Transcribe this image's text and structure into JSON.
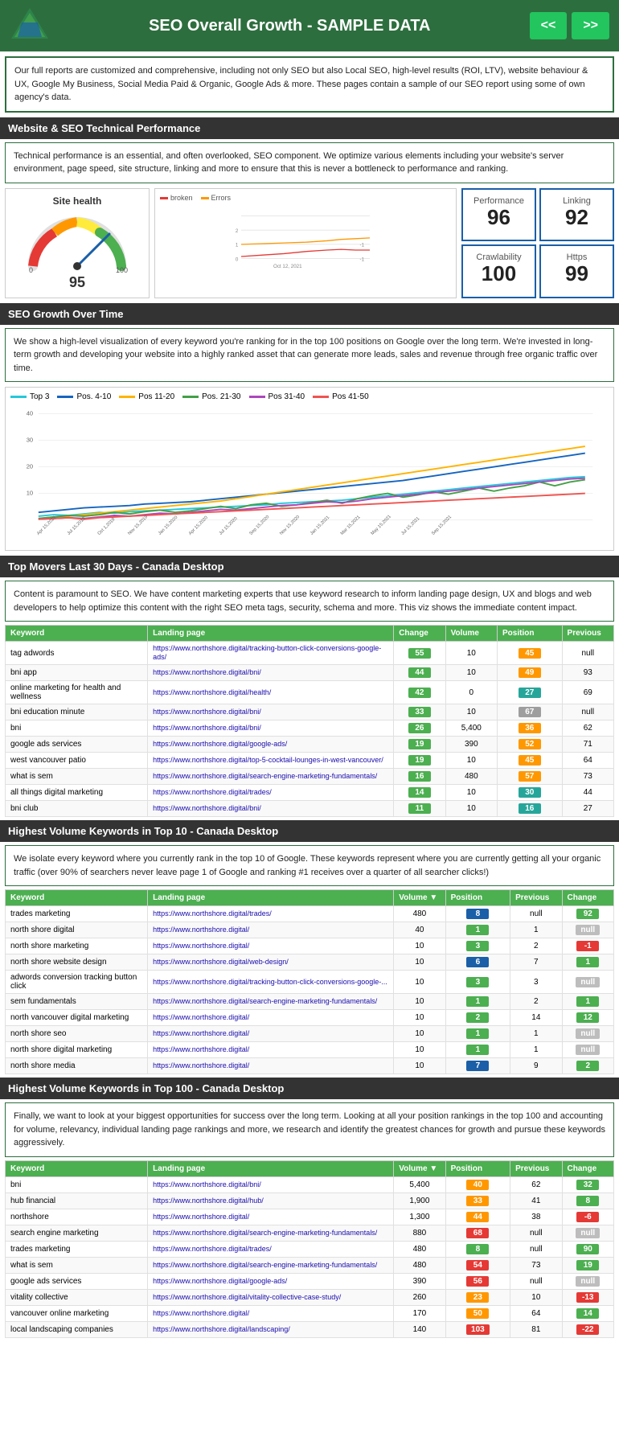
{
  "header": {
    "title": "SEO Overall Growth - SAMPLE DATA",
    "nav_prev": "<<",
    "nav_next": ">>"
  },
  "intro": {
    "text": "Our full reports are customized and comprehensive, including not only SEO but also Local SEO, high-level results (ROI, LTV), website behaviour & UX, Google My Business, Social Media Paid & Organic, Google Ads & more. These pages contain a sample of our SEO report using some of own agency's data."
  },
  "section_technical": {
    "title": "Website & SEO Technical Performance",
    "description": "Technical performance is an essential, and often overlooked, SEO component. We optimize various elements including your website's server environment, page speed, site structure, linking and more to ensure that this is never a bottleneck to performance and ranking.",
    "gauge": {
      "label": "Site health",
      "score": 95
    },
    "metrics": [
      {
        "label": "Performance",
        "value": "96"
      },
      {
        "label": "Linking",
        "value": "92"
      },
      {
        "label": "Crawlability",
        "value": "100"
      },
      {
        "label": "Https",
        "value": "99"
      }
    ],
    "chart_date": "Oct 12, 2021",
    "legend": [
      {
        "label": "broken",
        "color": "#e53935"
      },
      {
        "label": "Errors",
        "color": "#ff9800"
      }
    ]
  },
  "section_growth": {
    "title": "SEO Growth Over Time",
    "description": "We show a high-level visualization of every keyword you're ranking for in the top 100 positions on Google over the long term. We're invested in long-term growth and developing your website into a highly ranked asset that can generate more leads, sales and revenue through free organic traffic over time.",
    "legend": [
      {
        "label": "Top 3",
        "color": "#26c6da"
      },
      {
        "label": "Pos. 4-10",
        "color": "#1565c0"
      },
      {
        "label": "Pos 11-20",
        "color": "#ffb300"
      },
      {
        "label": "Pos. 21-30",
        "color": "#43a047"
      },
      {
        "label": "Pos 31-40",
        "color": "#ab47bc"
      },
      {
        "label": "Pos 41-50",
        "color": "#ef5350"
      }
    ]
  },
  "section_top_movers": {
    "title": "Top Movers Last 30 Days - Canada Desktop",
    "description": "Content is paramount to SEO. We have content marketing experts that use keyword research to inform landing page design, UX and blogs and web developers to help optimize this content with the right SEO meta tags, security, schema and more. This viz shows the immediate content impact.",
    "columns": [
      "Keyword",
      "Landing page",
      "Change",
      "Volume",
      "Position",
      "Previous"
    ],
    "rows": [
      {
        "keyword": "tag adwords",
        "url": "https://www.northshore.digital/tracking-button-click-conversions-google-ads/",
        "change": 55,
        "change_color": "green",
        "volume": 10,
        "position": 45,
        "previous": "null"
      },
      {
        "keyword": "bni app",
        "url": "https://www.northshore.digital/bni/",
        "change": 44,
        "change_color": "green",
        "volume": 10,
        "position": 49,
        "previous": 93
      },
      {
        "keyword": "online marketing for health and wellness",
        "url": "https://www.northshore.digital/health/",
        "change": 42,
        "change_color": "green",
        "volume": 0,
        "position": 27,
        "previous": 69
      },
      {
        "keyword": "bni education minute",
        "url": "https://www.northshore.digital/bni/",
        "change": 33,
        "change_color": "green",
        "volume": 10,
        "position": 67,
        "previous": "null"
      },
      {
        "keyword": "bni",
        "url": "https://www.northshore.digital/bni/",
        "change": 26,
        "change_color": "green",
        "volume": "5,400",
        "position": 36,
        "previous": 62
      },
      {
        "keyword": "google ads services",
        "url": "https://www.northshore.digital/google-ads/",
        "change": 19,
        "change_color": "green",
        "volume": 390,
        "position": 52,
        "previous": 71
      },
      {
        "keyword": "west vancouver patio",
        "url": "https://www.northshore.digital/top-5-cocktail-lounges-in-west-vancouver/",
        "change": 19,
        "change_color": "green",
        "volume": 10,
        "position": 45,
        "previous": 64
      },
      {
        "keyword": "what is sem",
        "url": "https://www.northshore.digital/search-engine-marketing-fundamentals/",
        "change": 16,
        "change_color": "green",
        "volume": 480,
        "position": 57,
        "previous": 73
      },
      {
        "keyword": "all things digital marketing",
        "url": "https://www.northshore.digital/trades/",
        "change": 14,
        "change_color": "green",
        "volume": 10,
        "position": 30,
        "previous": 44
      },
      {
        "keyword": "bni club",
        "url": "https://www.northshore.digital/bni/",
        "change": 11,
        "change_color": "green",
        "volume": 10,
        "position": 16,
        "previous": 27
      }
    ]
  },
  "section_top10": {
    "title": "Highest Volume Keywords in Top 10 - Canada Desktop",
    "description": "We isolate every keyword where you currently rank in the top 10 of Google. These keywords represent where you are currently getting all your organic traffic (over 90% of searchers never leave page 1 of Google and ranking #1 receives over a quarter of all searcher clicks!)",
    "columns": [
      "Keyword",
      "Landing page",
      "Volume ▼",
      "Position",
      "Previous",
      "Change"
    ],
    "rows": [
      {
        "keyword": "trades marketing",
        "url": "https://www.northshore.digital/trades/",
        "volume": 480,
        "position": 8,
        "previous": "null",
        "change": 92,
        "change_color": "green"
      },
      {
        "keyword": "north shore digital",
        "url": "https://www.northshore.digital/",
        "volume": 40,
        "position": 1,
        "previous": 1,
        "change": "null",
        "change_color": "null"
      },
      {
        "keyword": "north shore marketing",
        "url": "https://www.northshore.digital/",
        "volume": 10,
        "position": 3,
        "previous": 2,
        "change": -1,
        "change_color": "red"
      },
      {
        "keyword": "north shore website design",
        "url": "https://www.northshore.digital/web-design/",
        "volume": 10,
        "position": 6,
        "previous": 7,
        "change": 1,
        "change_color": "green"
      },
      {
        "keyword": "adwords conversion tracking button click",
        "url": "https://www.northshore.digital/tracking-button-click-conversions-google-...",
        "volume": 10,
        "position": 3,
        "previous": 3,
        "change": "null",
        "change_color": "null"
      },
      {
        "keyword": "sem fundamentals",
        "url": "https://www.northshore.digital/search-engine-marketing-fundamentals/",
        "volume": 10,
        "position": 1,
        "previous": 2,
        "change": 1,
        "change_color": "green"
      },
      {
        "keyword": "north vancouver digital marketing",
        "url": "https://www.northshore.digital/",
        "volume": 10,
        "position": 2,
        "previous": 14,
        "change": 12,
        "change_color": "green"
      },
      {
        "keyword": "north shore seo",
        "url": "https://www.northshore.digital/",
        "volume": 10,
        "position": 1,
        "previous": 1,
        "change": "null",
        "change_color": "null"
      },
      {
        "keyword": "north shore digital marketing",
        "url": "https://www.northshore.digital/",
        "volume": 10,
        "position": 1,
        "previous": 1,
        "change": "null",
        "change_color": "null"
      },
      {
        "keyword": "north shore media",
        "url": "https://www.northshore.digital/",
        "volume": 10,
        "position": 7,
        "previous": 9,
        "change": 2,
        "change_color": "green"
      }
    ]
  },
  "section_top100": {
    "title": "Highest Volume Keywords in Top 100 - Canada Desktop",
    "description": "Finally, we want to look at your biggest opportunities for success over the long term. Looking at all your position rankings in the top 100 and accounting for volume, relevancy, individual landing page rankings and more, we research and identify the greatest chances for growth and pursue these keywords aggressively.",
    "columns": [
      "Keyword",
      "Landing page",
      "Volume ▼",
      "Position",
      "Previous",
      "Change"
    ],
    "rows": [
      {
        "keyword": "bni",
        "url": "https://www.northshore.digital/bni/",
        "volume": "5,400",
        "position": 40,
        "previous": 62,
        "change": 32,
        "change_color": "green"
      },
      {
        "keyword": "hub financial",
        "url": "https://www.northshore.digital/hub/",
        "volume": "1,900",
        "position": 33,
        "previous": 41,
        "change": 8,
        "change_color": "green"
      },
      {
        "keyword": "northshore",
        "url": "https://www.northshore.digital/",
        "volume": "1,300",
        "position": 44,
        "previous": 38,
        "change": -6,
        "change_color": "red"
      },
      {
        "keyword": "search engine marketing",
        "url": "https://www.northshore.digital/search-engine-marketing-fundamentals/",
        "volume": 880,
        "position": 68,
        "previous": "null",
        "change": "null",
        "change_color": "null"
      },
      {
        "keyword": "trades marketing",
        "url": "https://www.northshore.digital/trades/",
        "volume": 480,
        "position": 8,
        "previous": "null",
        "change": 90,
        "change_color": "green"
      },
      {
        "keyword": "what is sem",
        "url": "https://www.northshore.digital/search-engine-marketing-fundamentals/",
        "volume": 480,
        "position": 54,
        "previous": 73,
        "change": 19,
        "change_color": "green"
      },
      {
        "keyword": "google ads services",
        "url": "https://www.northshore.digital/google-ads/",
        "volume": 390,
        "position": 56,
        "previous": "null",
        "change": "null",
        "change_color": "null"
      },
      {
        "keyword": "vitality collective",
        "url": "https://www.northshore.digital/vitality-collective-case-study/",
        "volume": 260,
        "position": 23,
        "previous": 10,
        "change": -13,
        "change_color": "red"
      },
      {
        "keyword": "vancouver online marketing",
        "url": "https://www.northshore.digital/",
        "volume": 170,
        "position": 50,
        "previous": 64,
        "change": 14,
        "change_color": "green"
      },
      {
        "keyword": "local landscaping companies",
        "url": "https://www.northshore.digital/landscaping/",
        "volume": 140,
        "position": 103,
        "previous": 81,
        "change": -22,
        "change_color": "red"
      }
    ]
  }
}
